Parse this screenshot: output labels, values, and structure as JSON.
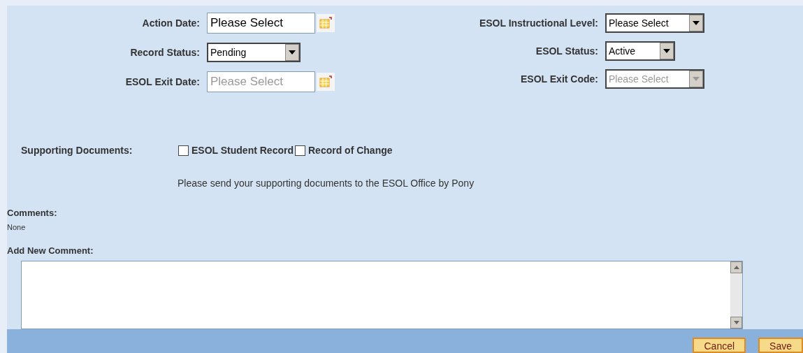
{
  "left_fields": [
    {
      "label": "Action Date:",
      "kind": "date",
      "value": "Please Select",
      "disabled": false
    },
    {
      "label": "Record Status:",
      "kind": "select",
      "value": "Pending",
      "disabled": false
    },
    {
      "label": "ESOL Exit Date:",
      "kind": "date",
      "value": "Please Select",
      "disabled": true
    }
  ],
  "right_fields": [
    {
      "label": "ESOL Instructional Level:",
      "kind": "select",
      "value": "Please Select",
      "disabled": false
    },
    {
      "label": "ESOL Status:",
      "kind": "select",
      "value": "Active",
      "disabled": false
    },
    {
      "label": "ESOL Exit Code:",
      "kind": "select",
      "value": "Please Select",
      "disabled": true
    }
  ],
  "supporting_documents": {
    "label": "Supporting Documents:",
    "options": [
      {
        "label": "ESOL Student Record",
        "checked": false
      },
      {
        "label": "Record of Change",
        "checked": false
      }
    ],
    "note": "Please send your supporting documents to the ESOL Office by Pony"
  },
  "comments": {
    "label": "Comments:",
    "text": "None"
  },
  "add_comment": {
    "label": "Add New Comment:"
  },
  "buttons": [
    "Cancel",
    "Save"
  ]
}
